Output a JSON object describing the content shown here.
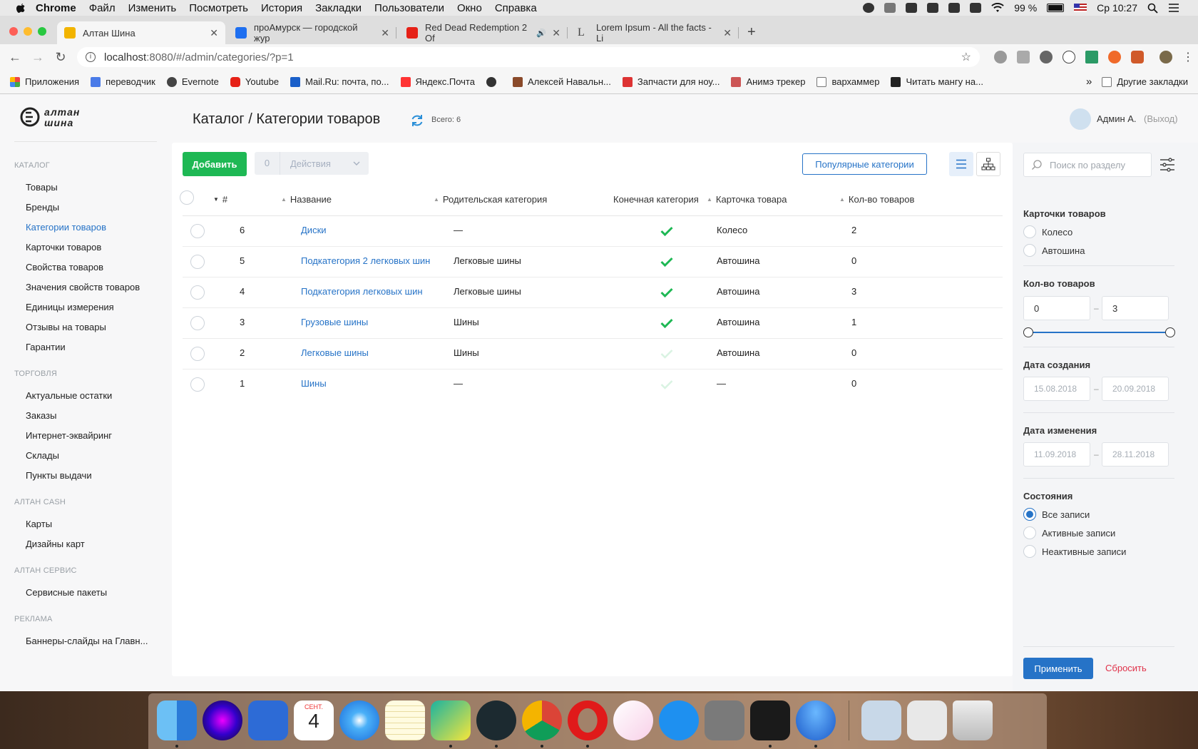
{
  "menubar": {
    "app": "Chrome",
    "items": [
      "Файл",
      "Изменить",
      "Посмотреть",
      "История",
      "Закладки",
      "Пользователи",
      "Окно",
      "Справка"
    ],
    "battery": "99 %",
    "clock": "Ср 10:27"
  },
  "tabs": [
    {
      "title": "Алтан Шина",
      "active": true,
      "color": "#f2b400"
    },
    {
      "title": "проАмурск — городской жур",
      "active": false,
      "color": "#1e6ff0"
    },
    {
      "title": "Red Dead Redemption 2 Of",
      "active": false,
      "color": "#e62117"
    },
    {
      "title": "Lorem Ipsum - All the facts - Li",
      "active": false,
      "color": "#444444"
    }
  ],
  "address": {
    "host": "localhost",
    "path": ":8080/#/admin/categories/?p=1"
  },
  "bookmarks": [
    {
      "label": "Приложения",
      "icon": "apps-grid-icon",
      "color": "#e44"
    },
    {
      "label": "переводчик",
      "icon": "translate-icon",
      "color": "#4a7be8"
    },
    {
      "label": "Evernote",
      "icon": "globe-icon",
      "color": "#444"
    },
    {
      "label": "Youtube",
      "icon": "youtube-icon",
      "color": "#e62117"
    },
    {
      "label": "Mail.Ru: почта, по...",
      "icon": "mailru-icon",
      "color": "#1a5fc9"
    },
    {
      "label": "Яндекс.Почта",
      "icon": "mail-icon",
      "color": "#f33"
    },
    {
      "label": "",
      "icon": "globe-icon",
      "color": "#333"
    },
    {
      "label": "Алексей Навальн...",
      "icon": "person-icon",
      "color": "#8a4a2a"
    },
    {
      "label": "Запчасти для ноу...",
      "icon": "tools-icon",
      "color": "#d33"
    },
    {
      "label": "Анимэ трекер",
      "icon": "anime-icon",
      "color": "#c55"
    },
    {
      "label": "вархаммер",
      "icon": "folder-icon",
      "color": "#888"
    },
    {
      "label": "Читать мангу на...",
      "icon": "manga-icon",
      "color": "#222"
    }
  ],
  "bookmarks_more": "»",
  "bookmarks_other": "Другие закладки",
  "sidebar": {
    "sections": [
      {
        "title": "КАТАЛОГ",
        "items": [
          "Товары",
          "Бренды",
          "Категории товаров",
          "Карточки товаров",
          "Свойства товаров",
          "Значения свойств товаров",
          "Единицы измерения",
          "Отзывы на товары",
          "Гарантии"
        ]
      },
      {
        "title": "ТОРГОВЛЯ",
        "items": [
          "Актуальные остатки",
          "Заказы",
          "Интернет-эквайринг",
          "Склады",
          "Пункты выдачи"
        ]
      },
      {
        "title": "АЛТАН CASH",
        "items": [
          "Карты",
          "Дизайны карт"
        ]
      },
      {
        "title": "АЛТАН СЕРВИС",
        "items": [
          "Сервисные пакеты"
        ]
      },
      {
        "title": "РЕКЛАМА",
        "items": [
          "Баннеры-слайды на Главн..."
        ]
      }
    ],
    "active": "Категории товаров"
  },
  "header": {
    "title": "Каталог / Категории товаров",
    "total": "Всего: 6",
    "user": "Админ А.",
    "logout": "(Выход)"
  },
  "toolbar": {
    "add": "Добавить",
    "selected_count": "0",
    "actions": "Действия",
    "popular": "Популярные категории"
  },
  "table": {
    "columns": [
      "#",
      "Название",
      "Родительская категория",
      "Конечная категория",
      "Карточка товара",
      "Кол-во товаров"
    ],
    "rows": [
      {
        "id": "6",
        "name": "Диски",
        "parent": "—",
        "final": true,
        "card": "Колесо",
        "count": "2"
      },
      {
        "id": "5",
        "name": "Подкатегория 2 легковых шин",
        "parent": "Легковые шины",
        "final": true,
        "card": "Автошина",
        "count": "0"
      },
      {
        "id": "4",
        "name": "Подкатегория легковых шин",
        "parent": "Легковые шины",
        "final": true,
        "card": "Автошина",
        "count": "3"
      },
      {
        "id": "3",
        "name": "Грузовые шины",
        "parent": "Шины",
        "final": true,
        "card": "Автошина",
        "count": "1"
      },
      {
        "id": "2",
        "name": "Легковые шины",
        "parent": "Шины",
        "final": false,
        "card": "Автошина",
        "count": "0"
      },
      {
        "id": "1",
        "name": "Шины",
        "parent": "—",
        "final": false,
        "card": "—",
        "count": "0"
      }
    ]
  },
  "filters": {
    "search_placeholder": "Поиск по разделу",
    "cards": {
      "title": "Карточки товаров",
      "options": [
        "Колесо",
        "Автошина"
      ]
    },
    "count": {
      "title": "Кол-во товаров",
      "from": "0",
      "to": "3"
    },
    "created": {
      "title": "Дата создания",
      "from": "15.08.2018",
      "to": "20.09.2018"
    },
    "modified": {
      "title": "Дата изменения",
      "from": "11.09.2018",
      "to": "28.11.2018"
    },
    "states": {
      "title": "Состояния",
      "options": [
        "Все записи",
        "Активные записи",
        "Неактивные записи"
      ],
      "selected": "Все записи"
    },
    "dash": "–",
    "apply": "Применить",
    "reset": "Сбросить"
  },
  "dock": {
    "apps": [
      {
        "name": "finder-icon",
        "color": "#3b9ae8"
      },
      {
        "name": "siri-icon",
        "color": "#3a2a6a"
      },
      {
        "name": "xcode-icon",
        "color": "#2d6bd6"
      },
      {
        "name": "calendar-icon",
        "color": "#ffffff"
      },
      {
        "name": "safari-icon",
        "color": "#2a86e8"
      },
      {
        "name": "notes-icon",
        "color": "#f5e27a"
      },
      {
        "name": "webstorm-icon",
        "color": "#1bb3a0"
      },
      {
        "name": "gitkraken-icon",
        "color": "#1c2a30"
      },
      {
        "name": "chrome-icon",
        "color": "#e8c030"
      },
      {
        "name": "opera-icon",
        "color": "#e01a1a"
      },
      {
        "name": "itunes-icon",
        "color": "#e858a8"
      },
      {
        "name": "app-store-icon",
        "color": "#1e90f0"
      },
      {
        "name": "system-preferences-icon",
        "color": "#7a7a7a"
      },
      {
        "name": "terminal-icon",
        "color": "#1a1a1a"
      },
      {
        "name": "yandex-disk-icon",
        "color": "#2a78e0"
      },
      {
        "name": "downloads-icon",
        "color": "#c8d8e8"
      },
      {
        "name": "documents-icon",
        "color": "#e8e8e8"
      },
      {
        "name": "trash-icon",
        "color": "#d8d8d8"
      }
    ],
    "calendar_month": "СЕНТ.",
    "calendar_day": "4"
  }
}
